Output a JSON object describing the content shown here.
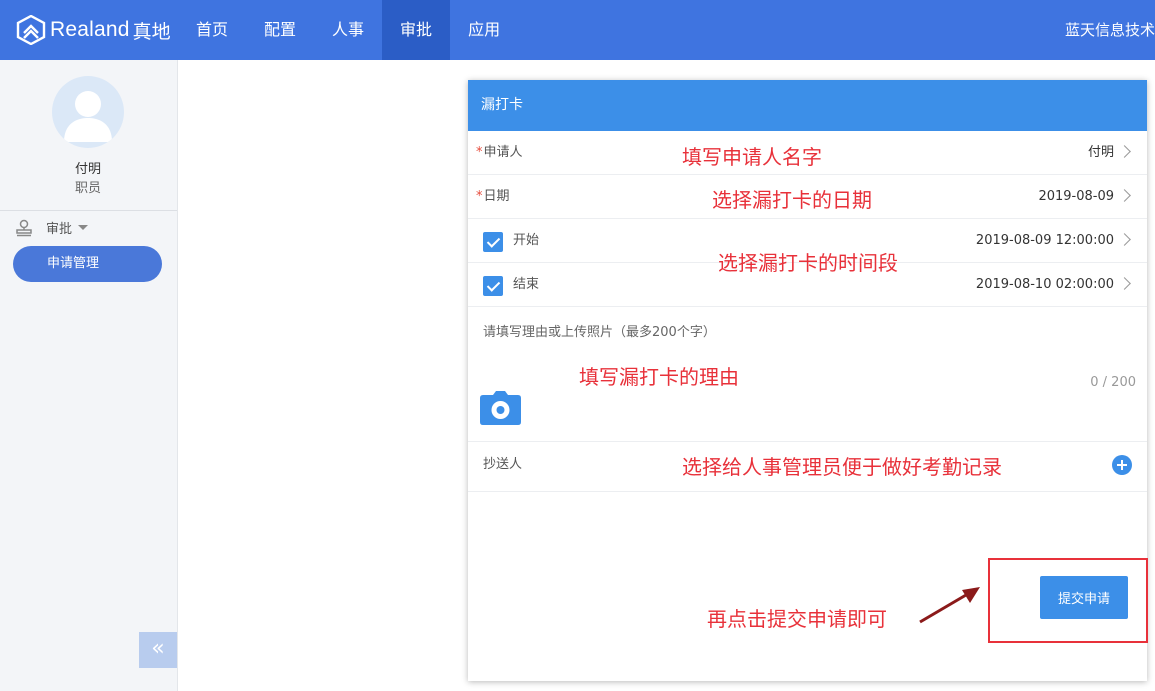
{
  "topbar": {
    "logo_text": "Realand",
    "logo_cn": "真地",
    "nav": [
      {
        "label": "首页",
        "active": false
      },
      {
        "label": "配置",
        "active": false
      },
      {
        "label": "人事",
        "active": false
      },
      {
        "label": "审批",
        "active": true
      },
      {
        "label": "应用",
        "active": false
      }
    ],
    "company": "蓝天信息技术"
  },
  "sidebar": {
    "user_name": "付明",
    "user_role": "职员",
    "group_label": "审批",
    "menu_button": "申请管理",
    "collapse_icon": "«"
  },
  "form": {
    "title": "漏打卡",
    "required_mark": "*",
    "applicant_label": "申请人",
    "applicant_value": "付明",
    "date_label": "日期",
    "date_value": "2019-08-09",
    "start_label": "开始",
    "start_value": "2019-08-09 12:00:00",
    "start_checked": true,
    "end_label": "结束",
    "end_value": "2019-08-10 02:00:00",
    "end_checked": true,
    "reason_placeholder": "请填写理由或上传照片（最多200个字）",
    "counter": "0 / 200",
    "cc_label": "抄送人",
    "submit_label": "提交申请"
  },
  "annotations": {
    "applicant": "填写申请人名字",
    "date": "选择漏打卡的日期",
    "time": "选择漏打卡的时间段",
    "reason": "填写漏打卡的理由",
    "cc": "选择给人事管理员便于做好考勤记录",
    "submit": "再点击提交申请即可"
  },
  "colors": {
    "topbar": "#3f74e0",
    "nav_active": "#2b5dc6",
    "panel_header": "#3c8fe8",
    "annotation": "#e8313a"
  }
}
